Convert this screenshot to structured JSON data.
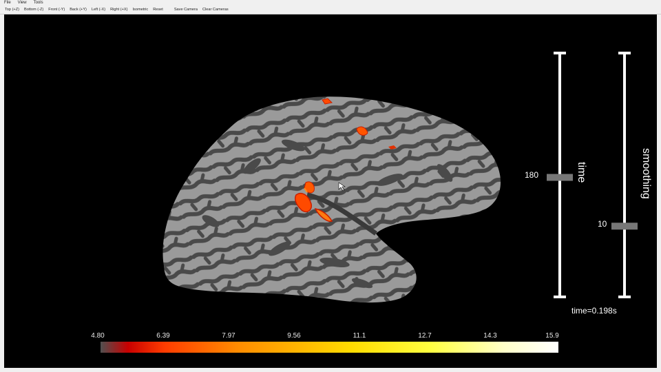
{
  "menubar": {
    "items": [
      "File",
      "View",
      "Tools"
    ]
  },
  "toolbar": {
    "buttons": [
      "Top (+Z)",
      "Bottom (-Z)",
      "Front (-Y)",
      "Back (+Y)",
      "Left (-X)",
      "Right (+X)",
      "Isometric",
      "Reset",
      "Save Camera",
      "Clear Cameras"
    ]
  },
  "sliders": {
    "time": {
      "label": "time",
      "value": "180",
      "fraction": 0.49
    },
    "smoothing": {
      "label": "smoothing",
      "value": "10",
      "fraction": 0.29
    }
  },
  "time_readout": "time=0.198s",
  "colorbar": {
    "ticks": [
      "4.80",
      "6.39",
      "7.97",
      "9.56",
      "11.1",
      "12.7",
      "14.3",
      "15.9"
    ],
    "min": 4.8,
    "max": 15.9,
    "colors": [
      "#505050",
      "#c80000",
      "#ff3c00",
      "#ff8c00",
      "#ffdc00",
      "#ffff40",
      "#ffffc8",
      "#ffffff"
    ]
  },
  "brain": {
    "surface_light": "#9a9a9a",
    "surface_dark": "#4a4a4a",
    "activation_colors": [
      "#ff4a00",
      "#ff7a10",
      "#c81e00"
    ]
  }
}
